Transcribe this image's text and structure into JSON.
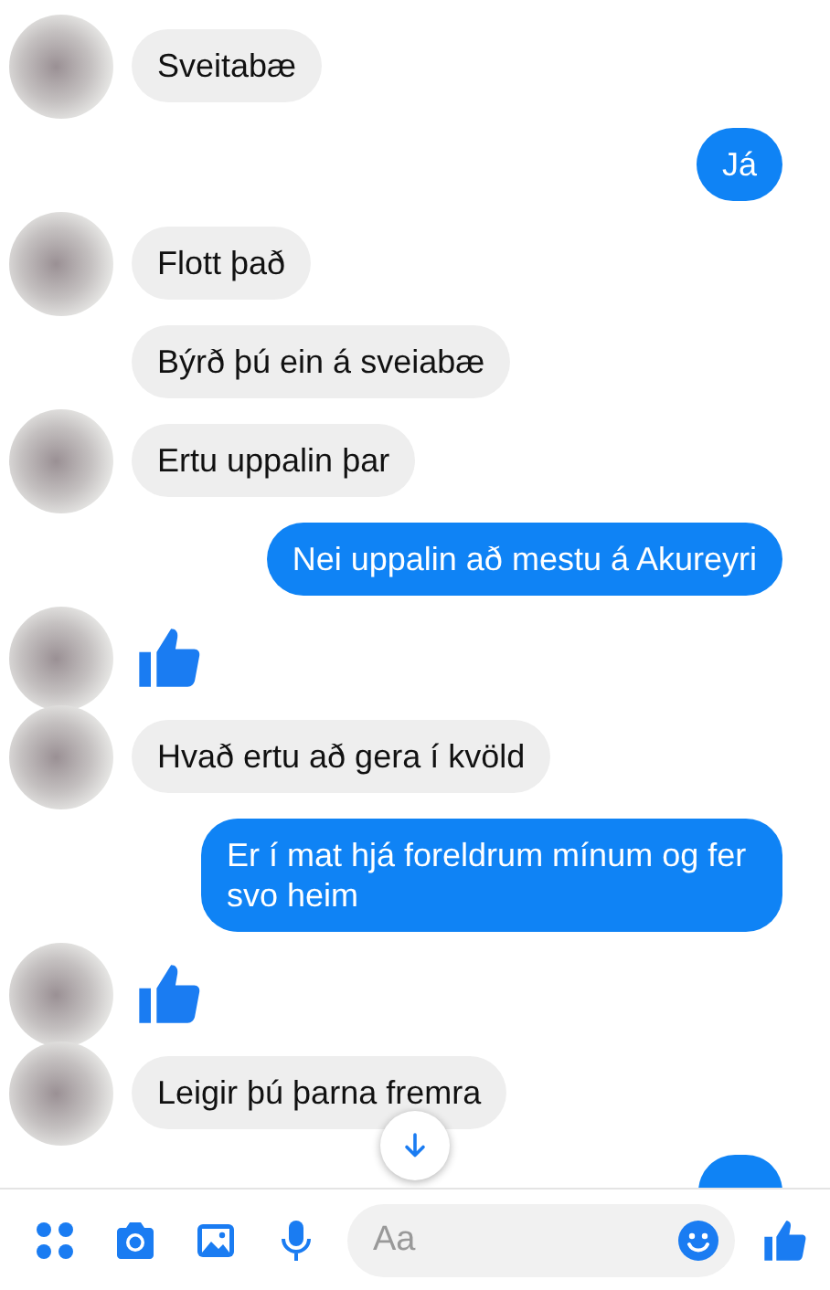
{
  "messages": [
    {
      "kind": "incoming",
      "avatar": true,
      "text": "Sveitabæ"
    },
    {
      "kind": "outgoing",
      "text": "Já"
    },
    {
      "kind": "incoming",
      "avatar": true,
      "text": "Flott það"
    },
    {
      "kind": "incoming",
      "avatar": false,
      "text": "Býrð þú ein á sveiabæ"
    },
    {
      "kind": "incoming",
      "avatar": true,
      "text": "Ertu uppalin þar"
    },
    {
      "kind": "outgoing",
      "text": "Nei uppalin að mestu á Akureyri"
    },
    {
      "kind": "like",
      "avatar": true
    },
    {
      "kind": "incoming",
      "avatar": true,
      "text": "Hvað ertu að gera í kvöld"
    },
    {
      "kind": "outgoing",
      "text": "Er í mat hjá foreldrum mínum og fer svo heim"
    },
    {
      "kind": "like",
      "avatar": true
    },
    {
      "kind": "incoming",
      "avatar": true,
      "text": "Leigir þú þarna fremra"
    },
    {
      "kind": "clipped"
    }
  ],
  "composer": {
    "placeholder": "Aa"
  }
}
